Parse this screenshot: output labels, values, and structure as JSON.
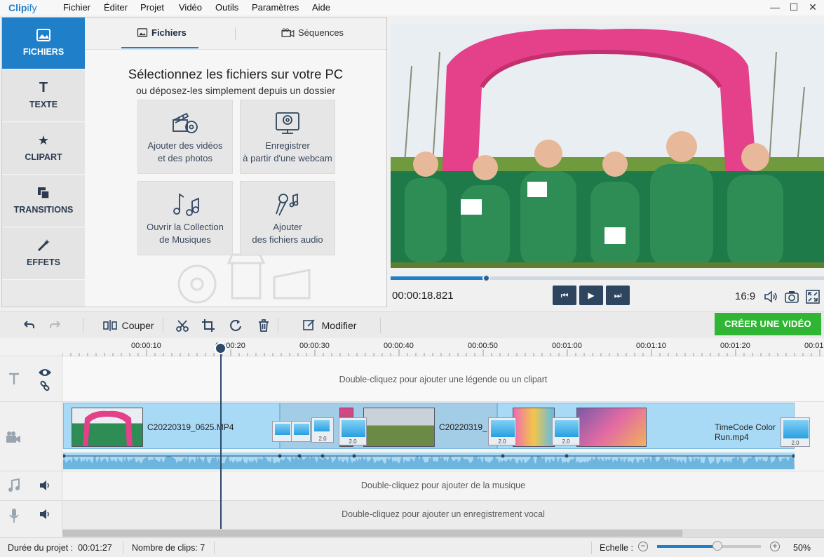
{
  "app": {
    "logo_a": "Clip",
    "logo_b": "ify"
  },
  "menu": [
    "Fichier",
    "Éditer",
    "Projet",
    "Vidéo",
    "Outils",
    "Paramètres",
    "Aide"
  ],
  "window": {
    "minimize": "—",
    "maximize": "☐",
    "close": "✕"
  },
  "sidebar": {
    "items": [
      {
        "label": "FICHIERS",
        "icon": "image-icon",
        "active": true
      },
      {
        "label": "TEXTE",
        "icon": "text-icon"
      },
      {
        "label": "CLIPART",
        "icon": "star-icon"
      },
      {
        "label": "TRANSITIONS",
        "icon": "transitions-icon"
      },
      {
        "label": "EFFETS",
        "icon": "magic-wand-icon"
      }
    ]
  },
  "tabs": {
    "files": "Fichiers",
    "sequences": "Séquences"
  },
  "panel": {
    "heading": "Sélectionnez les fichiers sur votre PC",
    "subheading": "ou déposez-les simplement depuis un dossier",
    "tiles": [
      {
        "line1": "Ajouter des vidéos",
        "line2": "et des photos",
        "icon": "film-camera-icon"
      },
      {
        "line1": "Enregistrer",
        "line2": "à partir d'une webcam",
        "icon": "webcam-icon"
      },
      {
        "line1": "Ouvrir la Collection",
        "line2": "de Musiques",
        "icon": "music-notes-icon"
      },
      {
        "line1": "Ajouter",
        "line2": "des fichiers audio",
        "icon": "microphone-icon"
      }
    ]
  },
  "player": {
    "timecode": "00:00:18.821",
    "ratio": "16:9",
    "progress_fraction": 0.22,
    "prev": "⏮",
    "play": "▶",
    "next": "⏭"
  },
  "toolbar": {
    "split": "Couper",
    "edit": "Modifier",
    "create": "CRÉER UNE VIDÉO"
  },
  "ruler": [
    "00:00:10",
    "00:00:20",
    "00:00:30",
    "00:00:40",
    "00:00:50",
    "00:01:00",
    "00:01:10",
    "00:01:20",
    "00:01"
  ],
  "timeline": {
    "caption_hint": "Double-cliquez pour ajouter une légende ou un clipart",
    "music_hint": "Double-cliquez pour ajouter de la musique",
    "voice_hint": "Double-cliquez pour ajouter un enregistrement vocal",
    "clips": [
      {
        "name": "C20220319_0625.MP4"
      },
      {
        "name": "C20220319_"
      },
      {
        "name": "TimeCode Color Run.mp4"
      }
    ],
    "transition_label": "2.0"
  },
  "status": {
    "duration_label": "Durée du projet :",
    "duration": "00:01:27",
    "clips_label": "Nombre de clips:",
    "clips_count": "7",
    "scale_label": "Echelle :",
    "zoom": "50%",
    "zoom_fraction": 0.58
  },
  "colors": {
    "accent": "#1f7fc9",
    "create": "#31b535",
    "dark": "#2e4560"
  }
}
